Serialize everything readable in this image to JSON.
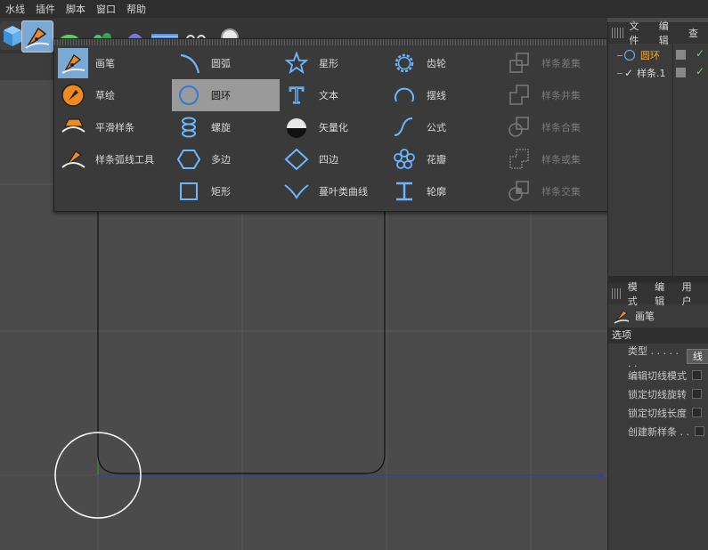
{
  "menubar": {
    "items": [
      "水线",
      "插件",
      "脚本",
      "窗口",
      "帮助"
    ]
  },
  "popup": {
    "columns": [
      [
        {
          "label": "画笔",
          "icon": "pen-icon"
        },
        {
          "label": "草绘",
          "icon": "sketch-icon"
        },
        {
          "label": "平滑样条",
          "icon": "smooth-spline-icon"
        },
        {
          "label": "样条弧线工具",
          "icon": "spline-arc-tool-icon"
        }
      ],
      [
        {
          "label": "圆弧",
          "icon": "arc-icon"
        },
        {
          "label": "圆环",
          "icon": "circle-icon",
          "selected": true
        },
        {
          "label": "螺旋",
          "icon": "helix-icon"
        },
        {
          "label": "多边",
          "icon": "polygon-icon"
        },
        {
          "label": "矩形",
          "icon": "rectangle-icon"
        }
      ],
      [
        {
          "label": "星形",
          "icon": "star-icon"
        },
        {
          "label": "文本",
          "icon": "text-icon"
        },
        {
          "label": "矢量化",
          "icon": "vectorizer-icon"
        },
        {
          "label": "四边",
          "icon": "four-side-icon"
        },
        {
          "label": "蔓叶类曲线",
          "icon": "cissoid-icon"
        }
      ],
      [
        {
          "label": "齿轮",
          "icon": "cog-icon"
        },
        {
          "label": "摆线",
          "icon": "cycloid-icon"
        },
        {
          "label": "公式",
          "icon": "formula-icon"
        },
        {
          "label": "花瓣",
          "icon": "flower-icon"
        },
        {
          "label": "轮廓",
          "icon": "profile-icon"
        }
      ],
      [
        {
          "label": "样条差集",
          "icon": "spline-subtract-icon",
          "disabled": true
        },
        {
          "label": "样条并集",
          "icon": "spline-union-icon",
          "disabled": true
        },
        {
          "label": "样条合集",
          "icon": "spline-and-icon",
          "disabled": true
        },
        {
          "label": "样条或集",
          "icon": "spline-or-icon",
          "disabled": true
        },
        {
          "label": "样条交集",
          "icon": "spline-intersect-icon",
          "disabled": true
        }
      ]
    ]
  },
  "objects_panel": {
    "tabs": [
      "文件",
      "编辑",
      "查"
    ],
    "objects": [
      {
        "name": "圆环",
        "color": "#f2a73a"
      },
      {
        "name": "样条.1",
        "color": "#d8d8d8"
      }
    ]
  },
  "attributes_panel": {
    "tabs": [
      "模式",
      "编辑",
      "用户"
    ],
    "tool_name": "画笔",
    "section": "选项",
    "type_label": "类型 . . . . . . .",
    "type_value": "线",
    "options": [
      "编辑切线模式",
      "锁定切线旋转",
      "锁定切线长度",
      "创建新样条 . ."
    ]
  },
  "colors": {
    "accent_selected": "#9a9a9a",
    "icon_blue": "#6bb6ff",
    "pen_orange": "#f08a1c",
    "active_object": "#f2a73a"
  }
}
